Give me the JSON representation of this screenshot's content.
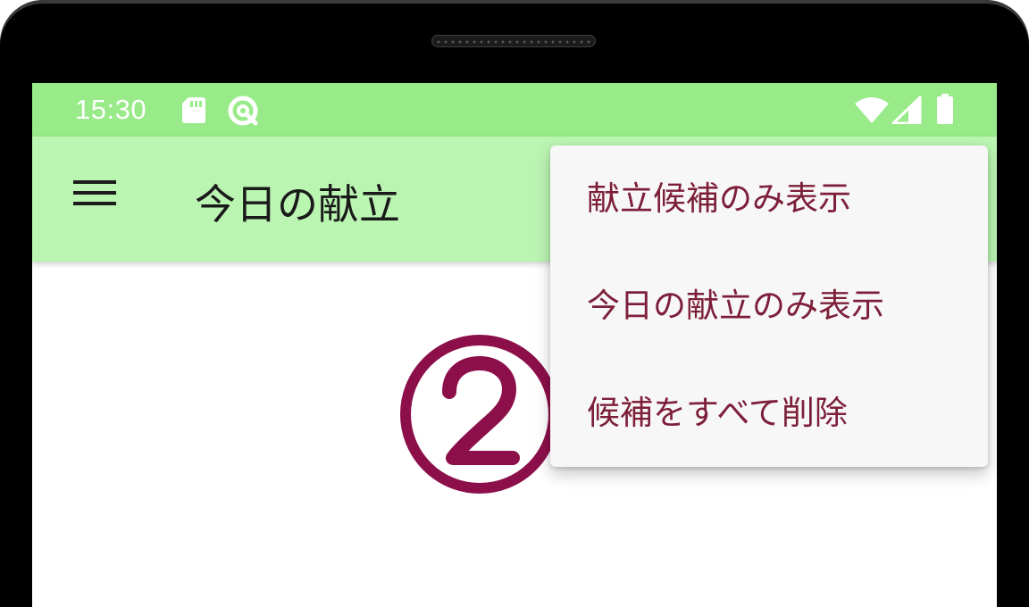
{
  "status_bar": {
    "time": "15:30",
    "left_icons": [
      "sd-card-icon",
      "sync-icon"
    ],
    "right_icons": [
      "wifi-icon",
      "signal-icon",
      "battery-icon"
    ]
  },
  "app_bar": {
    "menu_icon": "hamburger-menu-icon",
    "title": "今日の献立"
  },
  "overflow_menu": {
    "items": [
      {
        "label": "献立候補のみ表示"
      },
      {
        "label": "今日の献立のみ表示"
      },
      {
        "label": "候補をすべて削除"
      }
    ]
  },
  "annotation": {
    "label": "2"
  },
  "colors": {
    "status_bar": "#98eb88",
    "app_bar": "#bbf5b2",
    "menu_text": "#7d1f3a",
    "annotation": "#8c0f4a"
  }
}
